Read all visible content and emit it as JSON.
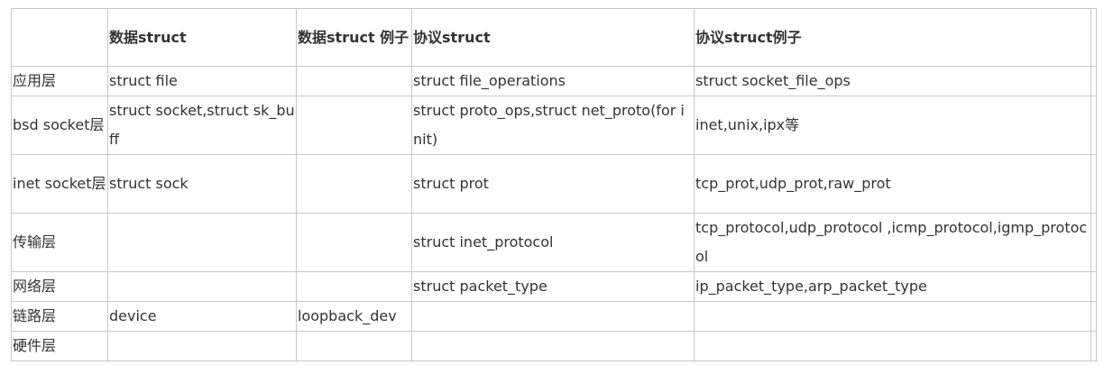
{
  "table": {
    "headers": [
      "",
      "数据struct",
      "数据struct 例子",
      "协议struct",
      "协议struct例子"
    ],
    "rows": [
      [
        "应用层",
        "struct file",
        "",
        "struct file_operations",
        "struct socket_file_ops"
      ],
      [
        "bsd socket层",
        "struct socket,struct sk_buff",
        "",
        "struct proto_ops,struct net_proto(for init)",
        "inet,unix,ipx等"
      ],
      [
        "inet socket层",
        "struct sock",
        "",
        "struct prot",
        "tcp_prot,udp_prot,raw_prot"
      ],
      [
        "传输层",
        "",
        "",
        "struct inet_protocol",
        "tcp_protocol,udp_protocol ,icmp_protocol,igmp_protocol"
      ],
      [
        "网络层",
        "",
        "",
        "struct packet_type",
        "ip_packet_type,arp_packet_type"
      ],
      [
        "链路层",
        "device",
        "loopback_dev",
        "",
        ""
      ],
      [
        "硬件层",
        "",
        "",
        "",
        ""
      ]
    ]
  }
}
